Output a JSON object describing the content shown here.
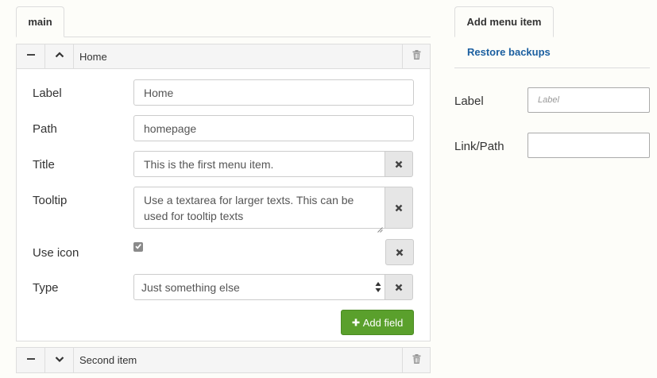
{
  "left_tabs": [
    {
      "label": "main"
    }
  ],
  "items": [
    {
      "title": "Home",
      "expanded": true,
      "fields": {
        "label": {
          "label": "Label",
          "value": "Home"
        },
        "path": {
          "label": "Path",
          "value": "homepage"
        },
        "title": {
          "label": "Title",
          "value": "This is the first menu item."
        },
        "tooltip": {
          "label": "Tooltip",
          "value": "Use a textarea for larger texts. This can be used for tooltip texts"
        },
        "use_icon": {
          "label": "Use icon",
          "checked": true
        },
        "type": {
          "label": "Type",
          "value": "Just something else"
        }
      },
      "add_field_label": "Add field"
    },
    {
      "title": "Second item",
      "expanded": false
    }
  ],
  "right": {
    "tabs": [
      {
        "label": "Add menu item"
      }
    ],
    "restore_link": "Restore backups",
    "form": {
      "label": {
        "label": "Label",
        "placeholder": "Label"
      },
      "link_path": {
        "label": "Link/Path",
        "placeholder": ""
      }
    }
  },
  "icons": {
    "collapse": "minus-icon",
    "up": "chevron-up-icon",
    "down": "chevron-down-icon",
    "trash": "trash-icon",
    "remove": "times-icon",
    "check": "check-icon",
    "plus": "plus-icon"
  },
  "colors": {
    "accent_link": "#1b5fa0",
    "add_button": "#5aa02c"
  }
}
